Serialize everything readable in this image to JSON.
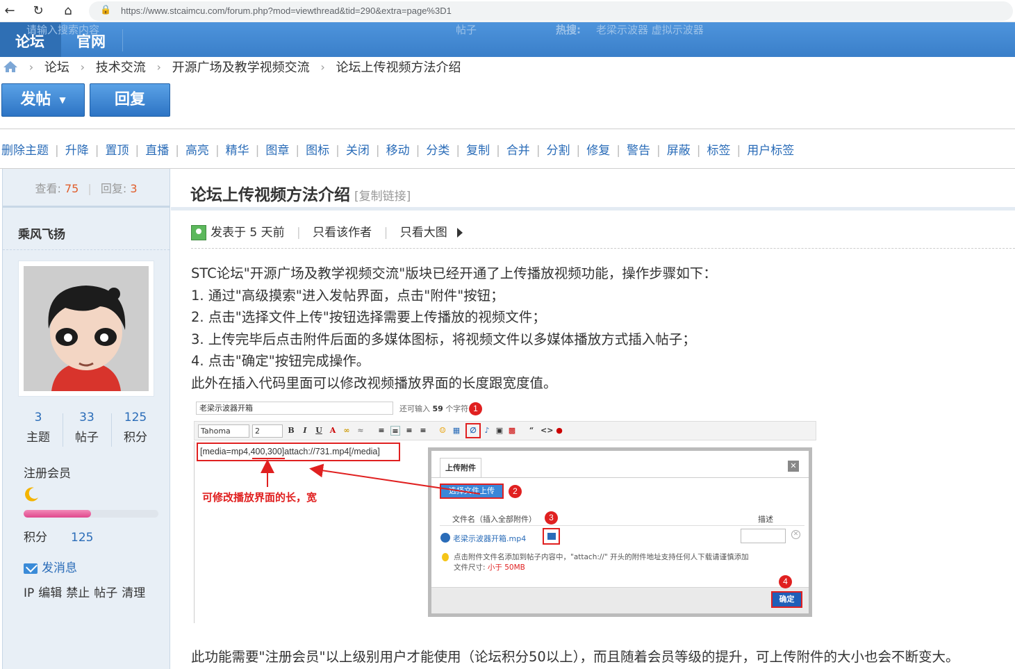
{
  "browser": {
    "url": "https://www.stcaimcu.com/forum.php?mod=viewthread&tid=290&extra=page%3D1"
  },
  "header": {
    "tabs": [
      "论坛",
      "官网"
    ],
    "ghost_search": "请输入搜索内容",
    "ghost_type": "帖子",
    "ghost_hot_label": "热搜:",
    "ghost_hot_terms": "老梁示波器  虚拟示波器"
  },
  "breadcrumb": [
    "论坛",
    "技术交流",
    "开源广场及教学视频交流",
    "论坛上传视频方法介绍"
  ],
  "actions": {
    "post": "发帖",
    "reply": "回复"
  },
  "moderation": [
    "删除主题",
    "升降",
    "置顶",
    "直播",
    "高亮",
    "精华",
    "图章",
    "图标",
    "关闭",
    "移动",
    "分类",
    "复制",
    "合并",
    "分割",
    "修复",
    "警告",
    "屏蔽",
    "标签",
    "用户标签"
  ],
  "thread_stats": {
    "views_label": "查看:",
    "views": "75",
    "replies_label": "回复:",
    "replies": "3"
  },
  "author": {
    "name": "乘风飞扬",
    "counts": [
      {
        "value": "3",
        "label": "主题"
      },
      {
        "value": "33",
        "label": "帖子"
      },
      {
        "value": "125",
        "label": "积分"
      }
    ],
    "group": "注册会员",
    "level_progress": 0.5,
    "score_label": "积分",
    "score": "125",
    "message": "发消息",
    "admin_links": [
      "IP",
      "编辑",
      "禁止",
      "帖子",
      "清理"
    ]
  },
  "post": {
    "title": "论坛上传视频方法介绍",
    "copy_link": "[复制链接]",
    "posted": "发表于 5 天前",
    "only_author": "只看该作者",
    "only_images": "只看大图",
    "lines": [
      "STC论坛\"开源广场及教学视频交流\"版块已经开通了上传播放视频功能，操作步骤如下：",
      "1. 通过\"高级摸索\"进入发帖界面，点击\"附件\"按钮；",
      "2. 点击\"选择文件上传\"按钮选择需要上传播放的视频文件；",
      "3. 上传完毕后点击附件后面的多媒体图标，将视频文件以多媒体播放方式插入帖子；",
      "4. 点击\"确定\"按钮完成操作。",
      "此外在插入代码里面可以修改视频播放界面的长度跟宽度值。"
    ],
    "footer": "此功能需要\"注册会员\"以上级别用户才能使用（论坛积分50以上），而且随着会员等级的提升，可上传附件的大小也会不断变大。"
  },
  "screenshot": {
    "subject_value": "老梁示波器开箱",
    "remain_prefix": "还可输入",
    "remain_count": "59",
    "remain_suffix": "个字符",
    "font_name": "Tahoma",
    "font_size": "2",
    "code": "[media=mp4,400,300]attach://731.mp4[/media]",
    "annotation": "可修改播放界面的长，宽",
    "dialog_tab": "上传附件",
    "upload_button": "选择文件上传",
    "col_file": "文件名（插入全部附件）",
    "col_desc": "描述",
    "file_name": "老梁示波器开箱.mp4",
    "tip_line1": "点击附件文件名添加到帖子内容中，\"attach://\" 开头的附件地址支持任何人下载请谨慎添加",
    "tip_size_label": "文件尺寸:",
    "tip_size_value": "小于 50MB",
    "ok_button": "确定",
    "badges": [
      "1",
      "2",
      "3",
      "4"
    ]
  }
}
